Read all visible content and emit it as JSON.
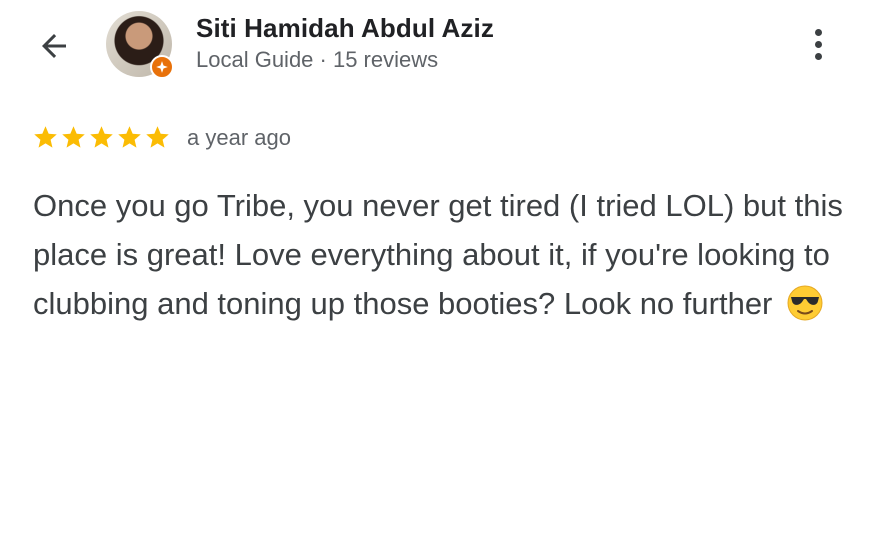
{
  "header": {
    "author_name": "Siti Hamidah Abdul Aziz",
    "author_meta": "Local Guide · 15 reviews",
    "back_icon": "arrow-back-icon",
    "more_icon": "more-vert-icon"
  },
  "review": {
    "rating": 5,
    "rating_max": 5,
    "date": "a year ago",
    "text": "Once you go Tribe, you never get tired (I tried LOL) but this place is great! Love everything about it, if you're looking to clubbing and toning up those booties? Look no further",
    "emoji": "smiling-face-with-sunglasses"
  },
  "colors": {
    "star": "#fbbc04",
    "badge": "#e8710a",
    "name": "#202124",
    "meta": "#5f6368",
    "body": "#3c4043"
  }
}
